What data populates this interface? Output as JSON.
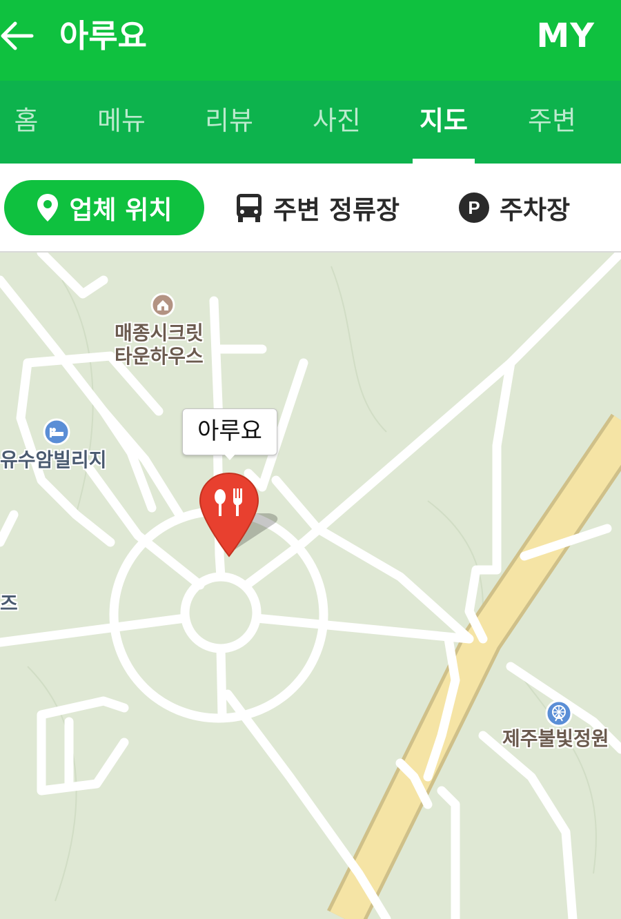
{
  "header": {
    "title": "아루요",
    "my_label": "MY"
  },
  "tabs": [
    {
      "label": "홈"
    },
    {
      "label": "메뉴"
    },
    {
      "label": "리뷰"
    },
    {
      "label": "사진"
    },
    {
      "label": "지도",
      "active": true
    },
    {
      "label": "주변"
    }
  ],
  "filters": {
    "business_location": "업체 위치",
    "nearby_stops": "주변 정류장",
    "parking": "주차장",
    "parking_badge": "P"
  },
  "map": {
    "pois": {
      "secret_townhouse_line1": "매종시크릿",
      "secret_townhouse_line2": "타운하우스",
      "yusuam_village": "유수암빌리지",
      "left_edge_fragment": "즈",
      "jeju_lights_garden": "제주불빛정원"
    },
    "marker_label": "아루요",
    "colors": {
      "background": "#dfe8d4",
      "road": "#ffffff",
      "highway": "#f5e4a5",
      "marker": "#e8402f"
    }
  },
  "theme": {
    "header_green": "#0fc13f",
    "tabs_green": "#0db34d"
  }
}
